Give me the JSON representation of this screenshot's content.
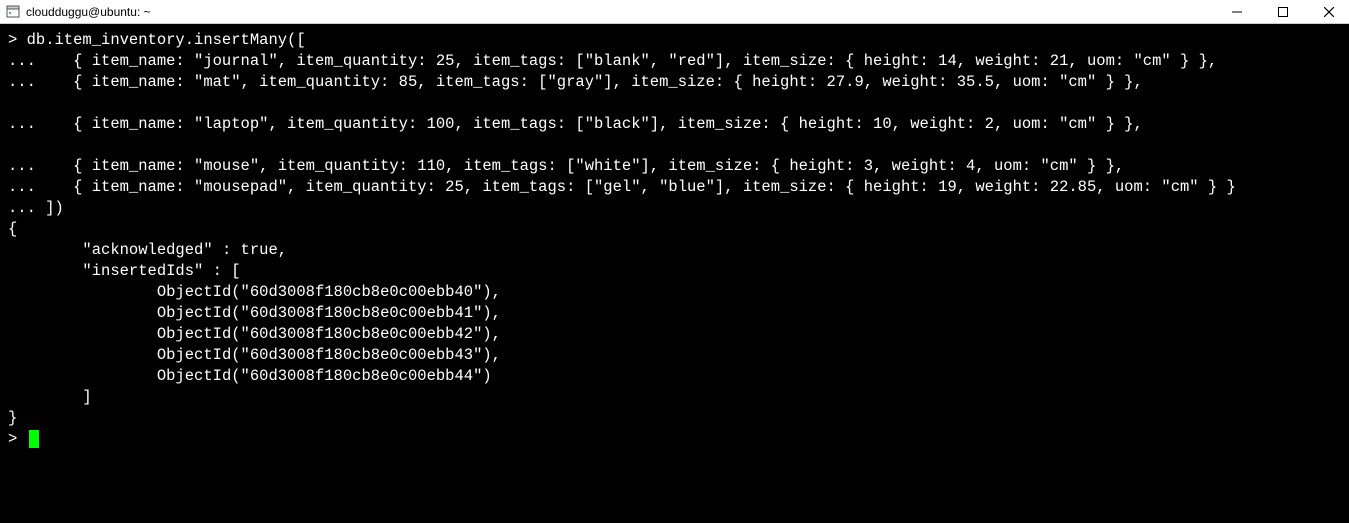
{
  "titlebar": {
    "title": "cloudduggu@ubuntu: ~",
    "minimize": "—",
    "maximize": "▢",
    "close": "✕"
  },
  "terminal": {
    "lines": [
      "> db.item_inventory.insertMany([",
      "...    { item_name: \"journal\", item_quantity: 25, item_tags: [\"blank\", \"red\"], item_size: { height: 14, weight: 21, uom: \"cm\" } },",
      "...    { item_name: \"mat\", item_quantity: 85, item_tags: [\"gray\"], item_size: { height: 27.9, weight: 35.5, uom: \"cm\" } },",
      "",
      "...    { item_name: \"laptop\", item_quantity: 100, item_tags: [\"black\"], item_size: { height: 10, weight: 2, uom: \"cm\" } },",
      "",
      "...    { item_name: \"mouse\", item_quantity: 110, item_tags: [\"white\"], item_size: { height: 3, weight: 4, uom: \"cm\" } },",
      "...    { item_name: \"mousepad\", item_quantity: 25, item_tags: [\"gel\", \"blue\"], item_size: { height: 19, weight: 22.85, uom: \"cm\" } }",
      "... ])",
      "{",
      "        \"acknowledged\" : true,",
      "        \"insertedIds\" : [",
      "                ObjectId(\"60d3008f180cb8e0c00ebb40\"),",
      "                ObjectId(\"60d3008f180cb8e0c00ebb41\"),",
      "                ObjectId(\"60d3008f180cb8e0c00ebb42\"),",
      "                ObjectId(\"60d3008f180cb8e0c00ebb43\"),",
      "                ObjectId(\"60d3008f180cb8e0c00ebb44\")",
      "        ]",
      "}",
      "> "
    ]
  }
}
